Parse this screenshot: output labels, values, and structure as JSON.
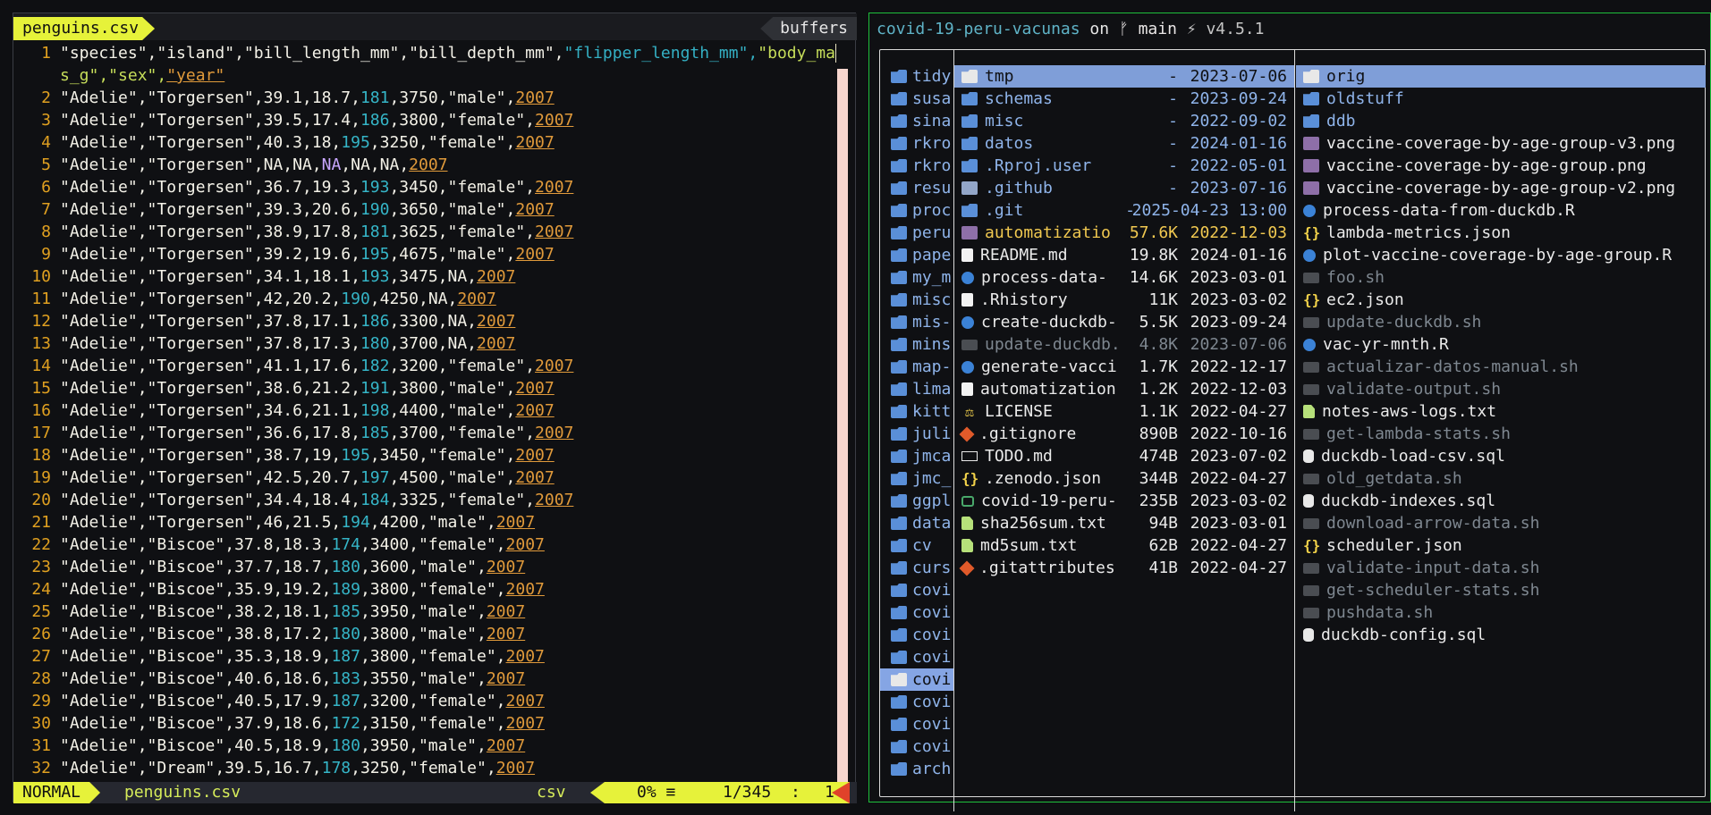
{
  "editor": {
    "tab_label": "penguins.csv",
    "buffers_label": "buffers",
    "header_line_1": {
      "h1": "\"species\",\"island\",\"bill_length_mm\",\"bill_depth_mm\",",
      "h2": "\"flipper_length_mm\",",
      "h3": "\"body_ma",
      "cursor": "s",
      "h3b": ""
    },
    "header_line_2": {
      "pre": "s_g\",\"sex\",",
      "year": "\"year\""
    },
    "rows": [
      [
        "2",
        "\"Adelie\",\"Torgersen\",39.1,18.7,",
        "181",
        ",3750,\"male\",",
        "2007"
      ],
      [
        "3",
        "\"Adelie\",\"Torgersen\",39.5,17.4,",
        "186",
        ",3800,\"female\",",
        "2007"
      ],
      [
        "4",
        "\"Adelie\",\"Torgersen\",40.3,18,",
        "195",
        ",3250,\"female\",",
        "2007"
      ],
      [
        "5",
        "\"Adelie\",\"Torgersen\",NA,NA,",
        "NA",
        ",NA,NA,",
        "2007"
      ],
      [
        "6",
        "\"Adelie\",\"Torgersen\",36.7,19.3,",
        "193",
        ",3450,\"female\",",
        "2007"
      ],
      [
        "7",
        "\"Adelie\",\"Torgersen\",39.3,20.6,",
        "190",
        ",3650,\"male\",",
        "2007"
      ],
      [
        "8",
        "\"Adelie\",\"Torgersen\",38.9,17.8,",
        "181",
        ",3625,\"female\",",
        "2007"
      ],
      [
        "9",
        "\"Adelie\",\"Torgersen\",39.2,19.6,",
        "195",
        ",4675,\"male\",",
        "2007"
      ],
      [
        "10",
        "\"Adelie\",\"Torgersen\",34.1,18.1,",
        "193",
        ",3475,NA,",
        "2007"
      ],
      [
        "11",
        "\"Adelie\",\"Torgersen\",42,20.2,",
        "190",
        ",4250,NA,",
        "2007"
      ],
      [
        "12",
        "\"Adelie\",\"Torgersen\",37.8,17.1,",
        "186",
        ",3300,NA,",
        "2007"
      ],
      [
        "13",
        "\"Adelie\",\"Torgersen\",37.8,17.3,",
        "180",
        ",3700,NA,",
        "2007"
      ],
      [
        "14",
        "\"Adelie\",\"Torgersen\",41.1,17.6,",
        "182",
        ",3200,\"female\",",
        "2007"
      ],
      [
        "15",
        "\"Adelie\",\"Torgersen\",38.6,21.2,",
        "191",
        ",3800,\"male\",",
        "2007"
      ],
      [
        "16",
        "\"Adelie\",\"Torgersen\",34.6,21.1,",
        "198",
        ",4400,\"male\",",
        "2007"
      ],
      [
        "17",
        "\"Adelie\",\"Torgersen\",36.6,17.8,",
        "185",
        ",3700,\"female\",",
        "2007"
      ],
      [
        "18",
        "\"Adelie\",\"Torgersen\",38.7,19,",
        "195",
        ",3450,\"female\",",
        "2007"
      ],
      [
        "19",
        "\"Adelie\",\"Torgersen\",42.5,20.7,",
        "197",
        ",4500,\"male\",",
        "2007"
      ],
      [
        "20",
        "\"Adelie\",\"Torgersen\",34.4,18.4,",
        "184",
        ",3325,\"female\",",
        "2007"
      ],
      [
        "21",
        "\"Adelie\",\"Torgersen\",46,21.5,",
        "194",
        ",4200,\"male\",",
        "2007"
      ],
      [
        "22",
        "\"Adelie\",\"Biscoe\",37.8,18.3,",
        "174",
        ",3400,\"female\",",
        "2007"
      ],
      [
        "23",
        "\"Adelie\",\"Biscoe\",37.7,18.7,",
        "180",
        ",3600,\"male\",",
        "2007"
      ],
      [
        "24",
        "\"Adelie\",\"Biscoe\",35.9,19.2,",
        "189",
        ",3800,\"female\",",
        "2007"
      ],
      [
        "25",
        "\"Adelie\",\"Biscoe\",38.2,18.1,",
        "185",
        ",3950,\"male\",",
        "2007"
      ],
      [
        "26",
        "\"Adelie\",\"Biscoe\",38.8,17.2,",
        "180",
        ",3800,\"male\",",
        "2007"
      ],
      [
        "27",
        "\"Adelie\",\"Biscoe\",35.3,18.9,",
        "187",
        ",3800,\"female\",",
        "2007"
      ],
      [
        "28",
        "\"Adelie\",\"Biscoe\",40.6,18.6,",
        "183",
        ",3550,\"male\",",
        "2007"
      ],
      [
        "29",
        "\"Adelie\",\"Biscoe\",40.5,17.9,",
        "187",
        ",3200,\"female\",",
        "2007"
      ],
      [
        "30",
        "\"Adelie\",\"Biscoe\",37.9,18.6,",
        "172",
        ",3150,\"female\",",
        "2007"
      ],
      [
        "31",
        "\"Adelie\",\"Biscoe\",40.5,18.9,",
        "180",
        ",3950,\"male\",",
        "2007"
      ],
      [
        "32",
        "\"Adelie\",\"Dream\",39.5,16.7,",
        "178",
        ",3250,\"female\",",
        "2007"
      ]
    ]
  },
  "statusline": {
    "mode": "NORMAL",
    "filename": "penguins.csv",
    "filetype": "csv",
    "percent": "0% ≡",
    "position": "1/345",
    "sep": ":",
    "column": "1"
  },
  "terminal": {
    "path": "covid-19-peru-vacunas",
    "on": " on ",
    "branch_icon": "ᚠ",
    "branch": " main ",
    "version_icon": "⚡",
    "version": " v4.5.1"
  },
  "lf": {
    "parent": [
      "tidy",
      "susa",
      "sina",
      "rkro",
      "rkro",
      "resu",
      "proc",
      "peru",
      "pape",
      "my_m",
      "misc",
      "mis-",
      "mins",
      "map-",
      "lima",
      "kitt",
      "juli",
      "jmca",
      "jmc_",
      "ggpl",
      "data",
      "cv",
      "curs",
      "covi",
      "covi",
      "covi",
      "covi",
      "covi",
      "covi",
      "covi",
      "covi",
      "arch"
    ],
    "parent_selected_index": 27,
    "current": [
      {
        "name": "tmp",
        "size": "-",
        "date": "2023-07-06",
        "icon": "folder-white",
        "color": "#0f1013"
      },
      {
        "name": "schemas",
        "size": "-",
        "date": "2023-09-24",
        "icon": "folder",
        "color": "#8fb4ea"
      },
      {
        "name": "misc",
        "size": "-",
        "date": "2022-09-02",
        "icon": "folder",
        "color": "#8fb4ea"
      },
      {
        "name": "datos",
        "size": "-",
        "date": "2024-01-16",
        "icon": "folder",
        "color": "#8fb4ea"
      },
      {
        "name": ".Rproj.user",
        "size": "-",
        "date": "2022-05-01",
        "icon": "folder",
        "color": "#8fb4ea"
      },
      {
        "name": ".github",
        "size": "-",
        "date": "2023-07-16",
        "icon": "github",
        "color": "#8fb4ea"
      },
      {
        "name": ".git",
        "size": "-",
        "date": "2025-04-23 13:00",
        "icon": "git-folder",
        "color": "#8fb4ea"
      },
      {
        "name": "automatizatio",
        "size": "57.6K",
        "date": "2022-12-03",
        "icon": "image",
        "color": "#f0c850"
      },
      {
        "name": "README.md",
        "size": "19.8K",
        "date": "2024-01-16",
        "icon": "doc",
        "color": "#eaeaea"
      },
      {
        "name": "process-data-",
        "size": "14.6K",
        "date": "2023-03-01",
        "icon": "r",
        "color": "#eaeaea"
      },
      {
        "name": ".Rhistory",
        "size": "11K",
        "date": "2023-03-02",
        "icon": "doc",
        "color": "#eaeaea"
      },
      {
        "name": "create-duckdb-",
        "size": "5.5K",
        "date": "2023-09-24",
        "icon": "r",
        "color": "#eaeaea"
      },
      {
        "name": "update-duckdb.",
        "size": "4.8K",
        "date": "2023-07-06",
        "icon": "shell",
        "color": "#7e8790"
      },
      {
        "name": "generate-vacci",
        "size": "1.7K",
        "date": "2022-12-17",
        "icon": "r",
        "color": "#eaeaea"
      },
      {
        "name": "automatization",
        "size": "1.2K",
        "date": "2022-12-03",
        "icon": "doc",
        "color": "#eaeaea"
      },
      {
        "name": "LICENSE",
        "size": "1.1K",
        "date": "2022-04-27",
        "icon": "license",
        "color": "#eaeaea"
      },
      {
        "name": ".gitignore",
        "size": "890B",
        "date": "2022-10-16",
        "icon": "git",
        "color": "#eaeaea"
      },
      {
        "name": "TODO.md",
        "size": "474B",
        "date": "2023-07-02",
        "icon": "markdown",
        "color": "#eaeaea"
      },
      {
        "name": ".zenodo.json",
        "size": "344B",
        "date": "2022-04-27",
        "icon": "json",
        "color": "#eaeaea"
      },
      {
        "name": "covid-19-peru-",
        "size": "235B",
        "date": "2023-03-02",
        "icon": "network",
        "color": "#eaeaea"
      },
      {
        "name": "sha256sum.txt",
        "size": "94B",
        "date": "2023-03-01",
        "icon": "text",
        "color": "#eaeaea"
      },
      {
        "name": "md5sum.txt",
        "size": "62B",
        "date": "2022-04-27",
        "icon": "text",
        "color": "#eaeaea"
      },
      {
        "name": ".gitattributes",
        "size": "41B",
        "date": "2022-04-27",
        "icon": "git",
        "color": "#eaeaea"
      }
    ],
    "preview": [
      {
        "name": "orig",
        "icon": "folder-white",
        "color": "#0f1013",
        "selected": true
      },
      {
        "name": "oldstuff",
        "icon": "folder",
        "color": "#8fb4ea"
      },
      {
        "name": "ddb",
        "icon": "folder",
        "color": "#8fb4ea"
      },
      {
        "name": "vaccine-coverage-by-age-group-v3.png",
        "icon": "image",
        "color": "#eaeaea"
      },
      {
        "name": "vaccine-coverage-by-age-group.png",
        "icon": "image",
        "color": "#eaeaea"
      },
      {
        "name": "vaccine-coverage-by-age-group-v2.png",
        "icon": "image",
        "color": "#eaeaea"
      },
      {
        "name": "process-data-from-duckdb.R",
        "icon": "r",
        "color": "#eaeaea"
      },
      {
        "name": "lambda-metrics.json",
        "icon": "json",
        "color": "#eaeaea"
      },
      {
        "name": "plot-vaccine-coverage-by-age-group.R",
        "icon": "r",
        "color": "#eaeaea"
      },
      {
        "name": "foo.sh",
        "icon": "shell",
        "color": "#7e8790"
      },
      {
        "name": "ec2.json",
        "icon": "json",
        "color": "#eaeaea"
      },
      {
        "name": "update-duckdb.sh",
        "icon": "shell",
        "color": "#7e8790"
      },
      {
        "name": "vac-yr-mnth.R",
        "icon": "r",
        "color": "#eaeaea"
      },
      {
        "name": "actualizar-datos-manual.sh",
        "icon": "shell",
        "color": "#7e8790"
      },
      {
        "name": "validate-output.sh",
        "icon": "shell",
        "color": "#7e8790"
      },
      {
        "name": "notes-aws-logs.txt",
        "icon": "text",
        "color": "#eaeaea"
      },
      {
        "name": "get-lambda-stats.sh",
        "icon": "shell",
        "color": "#7e8790"
      },
      {
        "name": "duckdb-load-csv.sql",
        "icon": "sql",
        "color": "#eaeaea"
      },
      {
        "name": "old_getdata.sh",
        "icon": "shell",
        "color": "#7e8790"
      },
      {
        "name": "duckdb-indexes.sql",
        "icon": "sql",
        "color": "#eaeaea"
      },
      {
        "name": "download-arrow-data.sh",
        "icon": "shell",
        "color": "#7e8790"
      },
      {
        "name": "scheduler.json",
        "icon": "json",
        "color": "#eaeaea"
      },
      {
        "name": "validate-input-data.sh",
        "icon": "shell",
        "color": "#7e8790"
      },
      {
        "name": "get-scheduler-stats.sh",
        "icon": "shell",
        "color": "#7e8790"
      },
      {
        "name": "pushdata.sh",
        "icon": "shell",
        "color": "#7e8790"
      },
      {
        "name": "duckdb-config.sql",
        "icon": "sql",
        "color": "#eaeaea"
      }
    ]
  }
}
